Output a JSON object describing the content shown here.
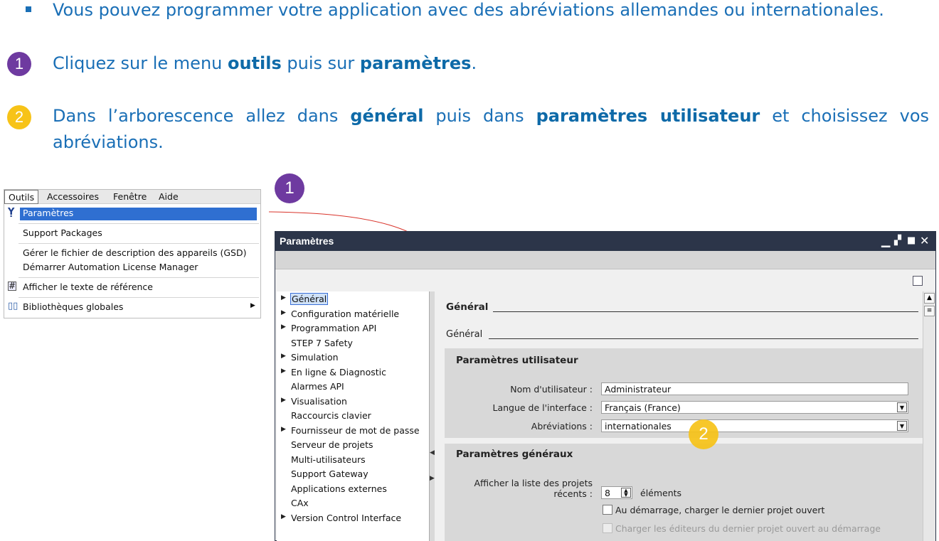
{
  "instructions": {
    "line1": "Vous pouvez programmer votre application avec des abréviations allemandes ou internationales.",
    "step1": {
      "number": "1",
      "pre": "Cliquez sur le menu ",
      "b1": "outils",
      "mid": " puis sur ",
      "b2": "paramètres",
      "post": "."
    },
    "step2": {
      "number": "2",
      "pre": "Dans l’arborescence allez dans ",
      "b1": "général",
      "mid": " puis dans ",
      "b2": "paramètres utilisateur",
      "post": " et choisissez vos",
      "line2": "abréviations."
    }
  },
  "callouts": {
    "one": "1",
    "two": "2"
  },
  "colors": {
    "accent": "#1a6fb6",
    "purple_badge": "#6e3aa0",
    "yellow_badge": "#f7c318",
    "titlebar": "#2c3549"
  },
  "menu": {
    "bar": [
      "Outils",
      "Accessoires",
      "Fenêtre",
      "Aide"
    ],
    "items": [
      {
        "label": "Paramètres",
        "icon": "wrench-icon"
      },
      {
        "label": "Support Packages"
      },
      {
        "label": "Gérer le fichier de description des appareils (GSD)"
      },
      {
        "label": "Démarrer Automation License Manager"
      },
      {
        "label": "Afficher le texte de référence",
        "icon": "reference-text-icon"
      },
      {
        "label": "Bibliothèques globales",
        "icon": "book-icon"
      }
    ]
  },
  "window": {
    "title": "Paramètres",
    "tree": [
      "Général",
      "Configuration matérielle",
      "Programmation API",
      "STEP 7 Safety",
      "Simulation",
      "En ligne & Diagnostic",
      "Alarmes API",
      "Visualisation",
      "Raccourcis clavier",
      "Fournisseur de mot de passe",
      "Serveur de projets",
      "Multi-utilisateurs",
      "Support Gateway",
      "Applications externes",
      "CAx",
      "Version Control Interface"
    ],
    "content": {
      "header": "Général",
      "subheader": "Général",
      "user_settings": {
        "title": "Paramètres utilisateur",
        "username_label": "Nom d'utilisateur :",
        "username_value": "Administrateur",
        "language_label": "Langue de l'interface :",
        "language_value": "Français (France)",
        "abbrev_label": "Abréviations :",
        "abbrev_value": "internationales"
      },
      "general_settings": {
        "title": "Paramètres généraux",
        "recent_label_1": "Afficher la liste des projets",
        "recent_label_2": "récents :",
        "recent_value": "8",
        "recent_unit": "éléments",
        "load_last": "Au démarrage, charger le dernier projet ouvert",
        "load_editors": "Charger les éditeurs du dernier projet ouvert au démarrage"
      }
    }
  }
}
